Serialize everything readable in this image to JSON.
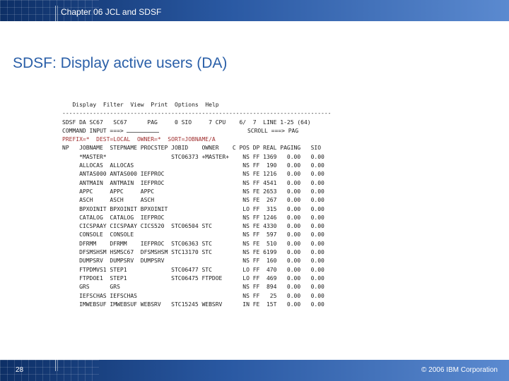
{
  "header": {
    "chapter": "Chapter 06 JCL and SDSF"
  },
  "slide": {
    "title": "SDSF: Display active users (DA)"
  },
  "terminal": {
    "menu": [
      "Display",
      "Filter",
      "View",
      "Print",
      "Options",
      "Help"
    ],
    "separator": "-------------------------------------------------------------------------------",
    "status_line": "SDSF DA SC67   SC67      PAG     0 SIO     7 CPU    6/  7  LINE 1-25 (64)",
    "command_label": "COMMAND INPUT ===>",
    "scroll_label": "SCROLL ===> PAG",
    "prefix_line": "PREFIX=*  DEST=LOCAL  OWNER=*  SORT=JOBNAME/A",
    "columns": "NP   JOBNAME  STEPNAME PROCSTEP JOBID    OWNER    C POS DP REAL PAGING   SIO",
    "rows": [
      "     *MASTER*                   STC06373 +MASTER+    NS FF 1369   0.00   0.00",
      "     ALLOCAS  ALLOCAS                                NS FF  190   0.00   0.00",
      "     ANTAS000 ANTAS000 IEFPROC                       NS FE 1216   0.00   0.00",
      "     ANTMAIN  ANTMAIN  IEFPROC                       NS FF 4541   0.00   0.00",
      "     APPC     APPC     APPC                          NS FE 2653   0.00   0.00",
      "     ASCH     ASCH     ASCH                          NS FE  267   0.00   0.00",
      "     BPXOINIT BPXOINIT BPXOINIT                      LO FF  315   0.00   0.00",
      "     CATALOG  CATALOG  IEFPROC                       NS FF 1246   0.00   0.00",
      "     CICSPAAY CICSPAAY CICS520  STC06504 STC         NS FE 4330   0.00   0.00",
      "     CONSOLE  CONSOLE                                NS FF  597   0.00   0.00",
      "     DFRMM    DFRMM    IEFPROC  STC06363 STC         NS FE  510   0.00   0.00",
      "     DFSMSHSM HSMSC67  DFSMSHSM STC13170 STC         NS FE 6199   0.00   0.00",
      "     DUMPSRV  DUMPSRV  DUMPSRV                       NS FF  160   0.00   0.00",
      "     FTPDMVS1 STEP1             STC06477 STC         LO FF  470   0.00   0.00",
      "     FTPDOE1  STEP1             STC06475 FTPDOE      LO FF  469   0.00   0.00",
      "     GRS      GRS                                    NS FF  894   0.00   0.00",
      "     IEFSCHAS IEFSCHAS                               NS FF   25   0.00   0.00",
      "     IMWEBSUF IMWEBSUF WEBSRV   STC15245 WEBSRV      IN FE  15T   0.00   0.00"
    ]
  },
  "footer": {
    "page_number": "28",
    "copyright": "© 2006 IBM Corporation"
  }
}
